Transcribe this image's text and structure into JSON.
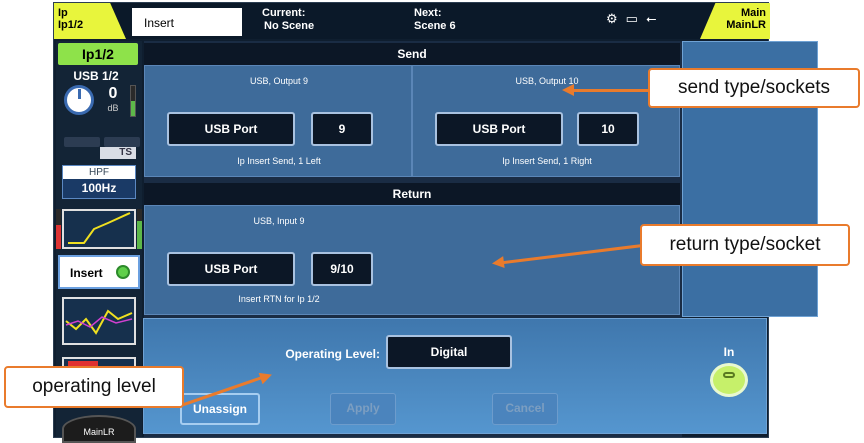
{
  "topbar": {
    "channel_line1": "Ip",
    "channel_line2": "Ip1/2",
    "tab_label": "Insert",
    "current_label": "Current:",
    "current_value": "No Scene",
    "next_label": "Next:",
    "next_value": "Scene 6",
    "icons": [
      "gear-lock-icon",
      "tape-icon",
      "usb-icon"
    ],
    "main_line1": "Main",
    "main_line2": "MainLR"
  },
  "strip": {
    "channel_name": "Ip1/2",
    "source": "USB 1/2",
    "gain_value": "0",
    "gain_unit": "dB",
    "phase_ts": "TS",
    "hpf_title": "HPF",
    "hpf_value": "100Hz",
    "insert_label": "Insert",
    "mainlr_label": "MainLR"
  },
  "send": {
    "title": "Send",
    "left": {
      "caption": "USB, Output 9",
      "type": "USB Port",
      "socket": "9",
      "desc": "Ip Insert Send, 1 Left"
    },
    "right": {
      "caption": "USB, Output 10",
      "type": "USB Port",
      "socket": "10",
      "desc": "Ip Insert Send, 1 Right"
    }
  },
  "return": {
    "title": "Return",
    "caption": "USB, Input 9",
    "type": "USB Port",
    "socket": "9/10",
    "desc": "Insert RTN for Ip 1/2"
  },
  "lower": {
    "operating_level_label": "Operating Level:",
    "operating_level_value": "Digital",
    "in_label": "In",
    "unassign_label": "Unassign",
    "apply_label": "Apply",
    "cancel_label": "Cancel"
  },
  "callouts": {
    "send": "send type/sockets",
    "return": "return type/socket",
    "operating": "operating level"
  },
  "colors": {
    "accent_yellow": "#e8f53c",
    "channel_green": "#8ee24a",
    "callout_orange": "#e97b2c",
    "panel_blue": "#3e6b9a"
  }
}
